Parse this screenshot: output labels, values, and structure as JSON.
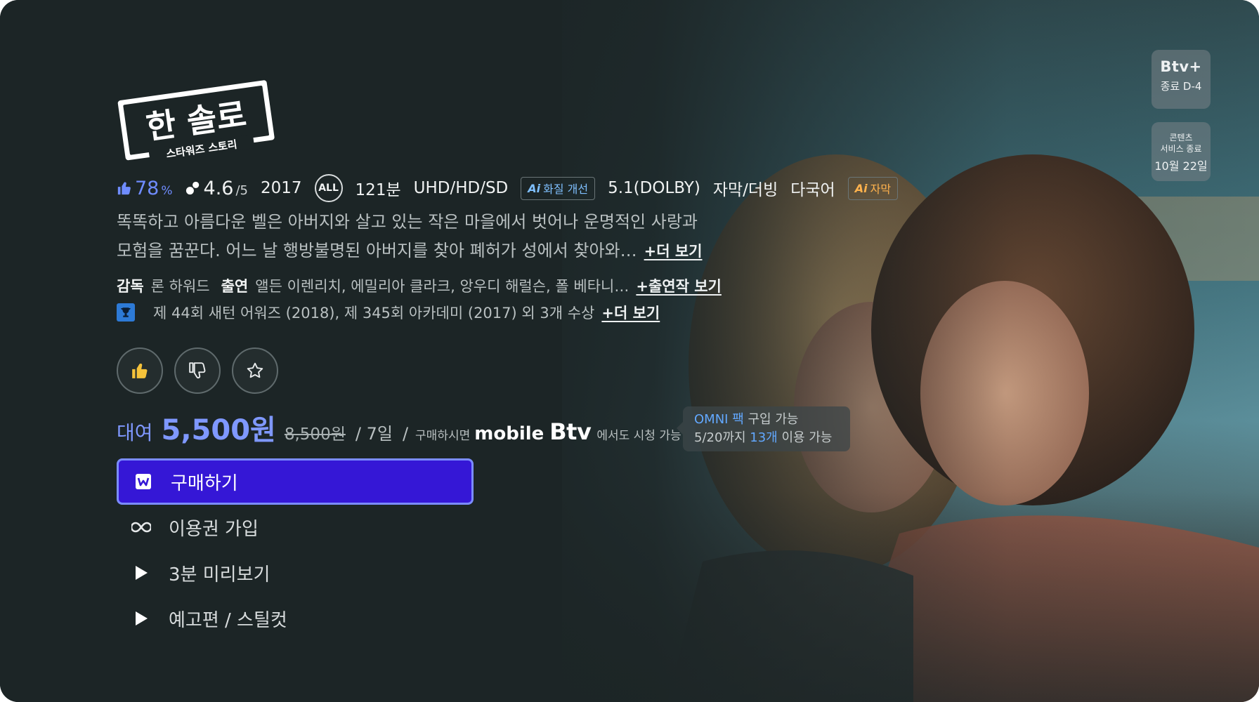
{
  "title": {
    "main": "한 솔로",
    "sub": "스타워즈 스토리"
  },
  "badges": {
    "btv_plus": {
      "logo": "Btv+",
      "sub": "종료 D-4"
    },
    "service_end": {
      "line1": "콘텐츠",
      "line2": "서비스 종료",
      "date": "10월 22일"
    }
  },
  "meta": {
    "like_percent": "78",
    "like_unit": "%",
    "rating": "4.6",
    "rating_unit": "/5",
    "year": "2017",
    "age_rating": "ALL",
    "runtime": "121분",
    "quality": "UHD/HD/SD",
    "ai_quality_tag": "화질 개선",
    "ai_label": "Ai",
    "audio": "5.1(DOLBY)",
    "subtitle_dub": "자막/더빙",
    "multi_lang": "다국어",
    "ai_subtitle_tag": "자막"
  },
  "synopsis": {
    "line1": "똑똑하고 아름다운 벨은 아버지와 살고 있는 작은 마을에서 벗어나 운명적인 사랑과",
    "line2": "모험을 꿈꾼다. 어느 날 행방불명된 아버지를 찾아 폐허가 성에서 찾아와…",
    "more": "+더 보기"
  },
  "crew": {
    "director_label": "감독",
    "director": "론 하워드",
    "cast_label": "출연",
    "cast": "앨든 이렌리치, 에밀리아 클라크, 앙우디 해럴슨, 폴 베타니…",
    "cast_more": "+출연작 보기"
  },
  "awards": {
    "text": "제 44회 새턴 어워즈 (2018), 제 345회 아카데미 (2017) 외 3개 수상",
    "more": "+더 보기"
  },
  "price": {
    "rent_label": "대여",
    "price": "5,500원",
    "original": "8,500원",
    "period": "/ 7일",
    "slash": "/",
    "purchase_note": "구매하시면",
    "mobile": "mobile",
    "btv": "Btv",
    "watch_note": "에서도 시청 가능"
  },
  "omni": {
    "pack": "OMNI 팩",
    "pack_suffix": " 구입 가능",
    "line2_prefix": "5/20까지 ",
    "count": "13개",
    "line2_suffix": " 이용 가능"
  },
  "menu": [
    {
      "label": "구매하기",
      "icon": "purchase-icon"
    },
    {
      "label": "이용권 가입",
      "icon": "infinity-icon"
    },
    {
      "label": "3분 미리보기",
      "icon": "play-icon"
    },
    {
      "label": "예고편 / 스틸컷",
      "icon": "play-icon"
    }
  ],
  "colors": {
    "accent": "#7f98ff",
    "active_button": "#3517d6",
    "background": "#1c2526"
  }
}
